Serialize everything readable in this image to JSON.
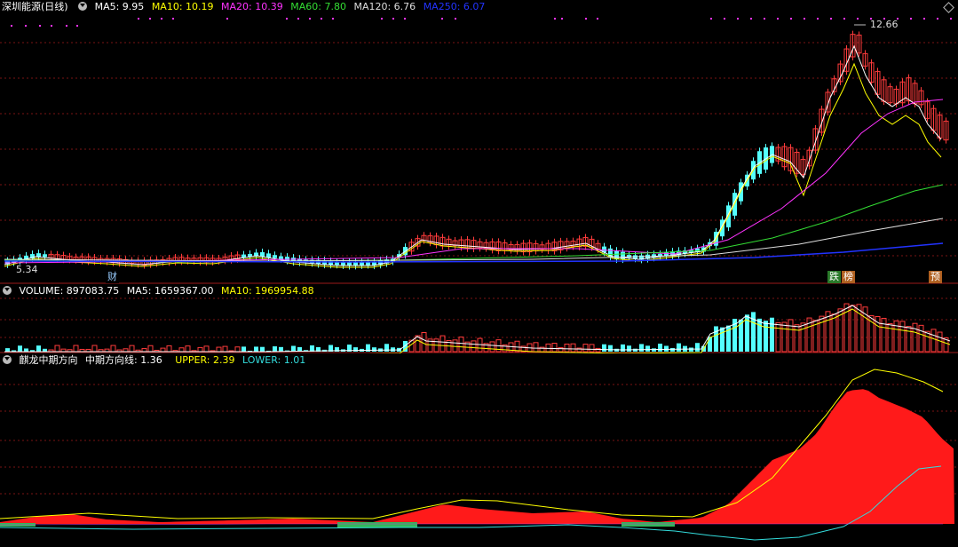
{
  "main": {
    "title": "深圳能源(日线)",
    "ma": [
      {
        "label": "MA5: 9.95",
        "color": "#ffffff"
      },
      {
        "label": "MA10: 10.19",
        "color": "#ffff00"
      },
      {
        "label": "MA20: 10.39",
        "color": "#ff33ff"
      },
      {
        "label": "MA60: 7.80",
        "color": "#33dd33"
      },
      {
        "label": "MA120: 6.76",
        "color": "#dddddd"
      },
      {
        "label": "MA250: 6.07",
        "color": "#2233ff"
      }
    ],
    "high_label": "12.66",
    "low_label": "5.34",
    "tags": [
      "财",
      "跌",
      "榜",
      "预"
    ]
  },
  "volume": {
    "items": [
      {
        "label": "VOLUME: 897083.75",
        "color": "#ffffff"
      },
      {
        "label": "MA5: 1659367.00",
        "color": "#ffffff"
      },
      {
        "label": "MA10: 1969954.88",
        "color": "#ffff00"
      }
    ]
  },
  "indicator": {
    "title": "麒龙中期方向",
    "items": [
      {
        "label": "中期方向线: 1.36",
        "color": "#ffffff"
      },
      {
        "label": "UPPER: 2.39",
        "color": "#ffff00"
      },
      {
        "label": "LOWER: 1.01",
        "color": "#33dddd"
      }
    ]
  }
}
